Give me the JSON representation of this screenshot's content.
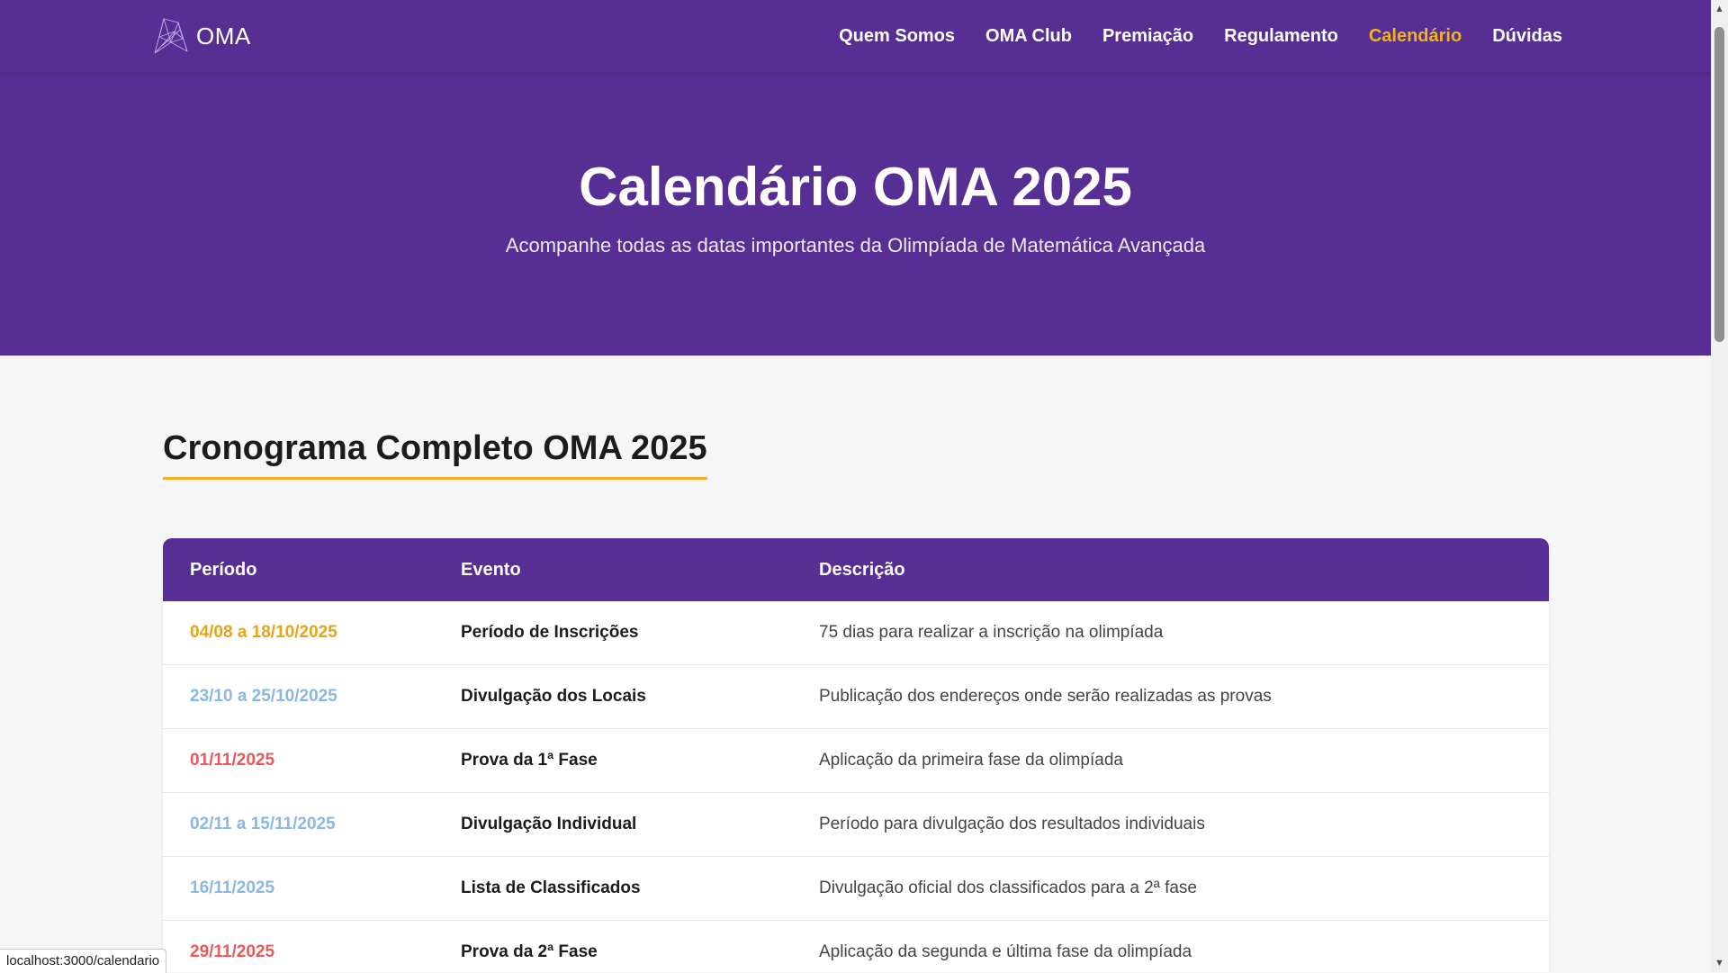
{
  "nav": {
    "logo_text": "OMA",
    "links": [
      {
        "label": "Quem Somos",
        "active": false
      },
      {
        "label": "OMA Club",
        "active": false
      },
      {
        "label": "Premiação",
        "active": false
      },
      {
        "label": "Regulamento",
        "active": false
      },
      {
        "label": "Calendário",
        "active": true
      },
      {
        "label": "Dúvidas",
        "active": false
      }
    ]
  },
  "hero": {
    "title": "Calendário OMA 2025",
    "subtitle": "Acompanhe todas as datas importantes da Olimpíada de Matemática Avançada"
  },
  "section": {
    "title": "Cronograma Completo OMA 2025"
  },
  "table": {
    "headers": [
      "Período",
      "Evento",
      "Descrição"
    ],
    "rows": [
      {
        "period": "04/08 a 18/10/2025",
        "period_color": "#e8a317",
        "event": "Período de Inscrições",
        "description": "75 dias para realizar a inscrição na olimpíada"
      },
      {
        "period": "23/10 a 25/10/2025",
        "period_color": "#8ab8e6",
        "event": "Divulgação dos Locais",
        "description": "Publicação dos endereços onde serão realizadas as provas"
      },
      {
        "period": "01/11/2025",
        "period_color": "#e85a5a",
        "event": "Prova da 1ª Fase",
        "description": "Aplicação da primeira fase da olimpíada"
      },
      {
        "period": "02/11 a 15/11/2025",
        "period_color": "#8ab8e6",
        "event": "Divulgação Individual",
        "description": "Período para divulgação dos resultados individuais"
      },
      {
        "period": "16/11/2025",
        "period_color": "#8ab8e6",
        "event": "Lista de Classificados",
        "description": "Divulgação oficial dos classificados para a 2ª fase"
      },
      {
        "period": "29/11/2025",
        "period_color": "#e85a5a",
        "event": "Prova da 2ª Fase",
        "description": "Aplicação da segunda e última fase da olimpíada"
      }
    ]
  },
  "colors": {
    "brand_purple": "#572e93",
    "accent_yellow": "#f1b221"
  },
  "status_bar": {
    "url": "localhost:3000/calendario"
  }
}
